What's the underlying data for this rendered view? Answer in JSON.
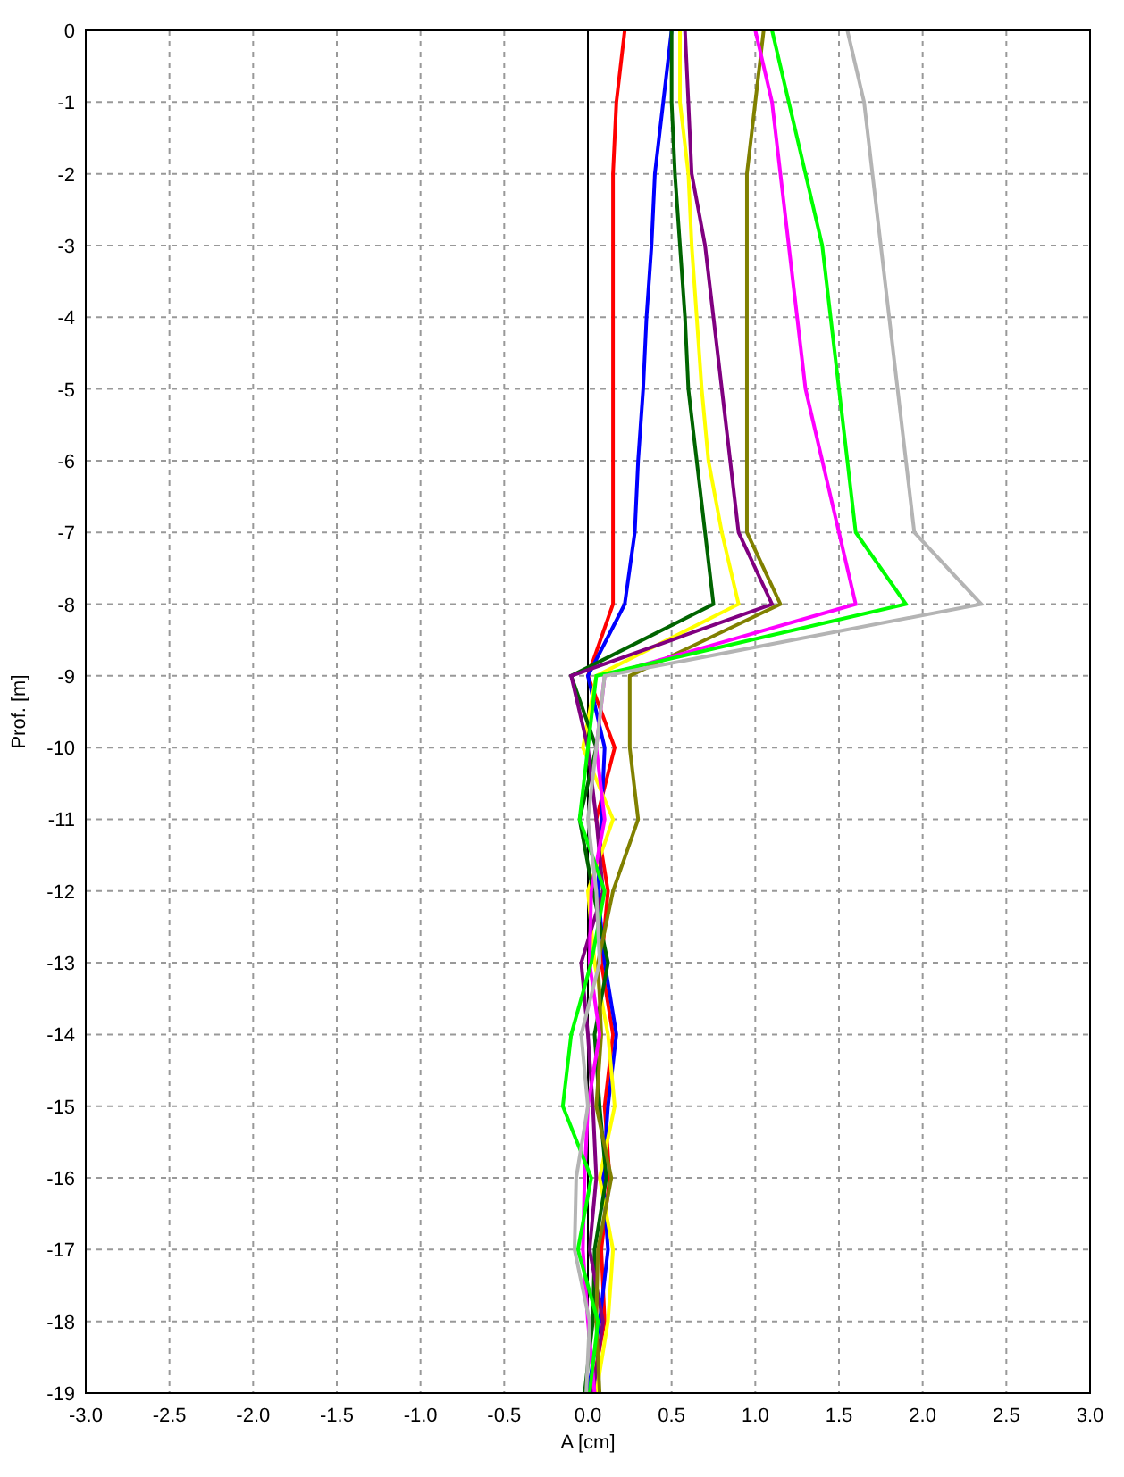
{
  "chart": {
    "chart_data": {
      "type": "line",
      "orientation": "horizontal",
      "grid": true,
      "xlabel": "A [cm]",
      "ylabel": "Prof. [m]",
      "xlim": [
        -3,
        3
      ],
      "xticks": [
        {
          "value": -3,
          "label": "-3.0"
        },
        {
          "value": -2.5,
          "label": "-2.5"
        },
        {
          "value": -2,
          "label": "-2.0"
        },
        {
          "value": -1.5,
          "label": "-1.5"
        },
        {
          "value": -1,
          "label": "-1.0"
        },
        {
          "value": -0.5,
          "label": "-0.5"
        },
        {
          "value": 0,
          "label": "0.0"
        },
        {
          "value": 0.5,
          "label": "0.5"
        },
        {
          "value": 1,
          "label": "1.0"
        },
        {
          "value": 1.5,
          "label": "1.5"
        },
        {
          "value": 2,
          "label": "2.0"
        },
        {
          "value": 2.5,
          "label": "2.5"
        },
        {
          "value": 3,
          "label": "3.0"
        }
      ],
      "categories": [
        "0",
        "-1",
        "-2",
        "-3",
        "-4",
        "-5",
        "-6",
        "-7",
        "-8",
        "-9",
        "-10",
        "-11",
        "-12",
        "-13",
        "-14",
        "-15",
        "-16",
        "-17",
        "-18",
        "-19"
      ],
      "series": [
        {
          "color": "#ff0000",
          "values": [
            0.22,
            0.17,
            0.15,
            0.15,
            0.15,
            0.15,
            0.15,
            0.15,
            0.15,
            0.0,
            0.16,
            0.05,
            0.12,
            0.08,
            0.15,
            0.1,
            0.13,
            0.08,
            0.1,
            0.02
          ]
        },
        {
          "color": "#0000ff",
          "values": [
            0.5,
            0.45,
            0.4,
            0.38,
            0.35,
            0.33,
            0.3,
            0.28,
            0.22,
            0.0,
            0.1,
            0.08,
            0.06,
            0.1,
            0.17,
            0.12,
            0.09,
            0.12,
            0.07,
            0.0
          ]
        },
        {
          "color": "#ffff00",
          "values": [
            0.55,
            0.55,
            0.6,
            0.62,
            0.65,
            0.68,
            0.72,
            0.8,
            0.9,
            0.05,
            -0.03,
            0.15,
            0.0,
            0.04,
            0.12,
            0.16,
            0.07,
            0.15,
            0.12,
            0.05
          ]
        },
        {
          "color": "#006400",
          "values": [
            0.5,
            0.5,
            0.52,
            0.55,
            0.58,
            0.6,
            0.65,
            0.7,
            0.75,
            -0.1,
            0.05,
            -0.05,
            0.03,
            0.12,
            0.04,
            0.07,
            0.11,
            0.04,
            0.03,
            -0.02
          ]
        },
        {
          "color": "#800080",
          "values": [
            0.58,
            0.6,
            0.62,
            0.7,
            0.75,
            0.8,
            0.85,
            0.9,
            1.1,
            -0.1,
            0.0,
            0.05,
            0.09,
            -0.04,
            0.0,
            0.03,
            0.05,
            0.01,
            0.09,
            0.03
          ]
        },
        {
          "color": "#808000",
          "values": [
            1.05,
            1.0,
            0.95,
            0.95,
            0.95,
            0.95,
            0.95,
            0.95,
            1.15,
            0.25,
            0.25,
            0.3,
            0.15,
            0.06,
            0.08,
            0.05,
            0.14,
            0.06,
            0.05,
            0.07
          ]
        },
        {
          "color": "#ff00ff",
          "values": [
            1.0,
            1.1,
            1.15,
            1.2,
            1.25,
            1.3,
            1.4,
            1.5,
            1.6,
            0.1,
            0.05,
            0.1,
            0.02,
            0.01,
            0.07,
            0.0,
            -0.02,
            -0.03,
            0.0,
            0.04
          ]
        },
        {
          "color": "#00ff00",
          "values": [
            1.1,
            1.2,
            1.3,
            1.4,
            1.45,
            1.5,
            1.55,
            1.6,
            1.9,
            0.05,
            0.0,
            -0.05,
            0.1,
            0.02,
            -0.1,
            -0.15,
            0.02,
            -0.06,
            0.06,
            0.01
          ]
        },
        {
          "color": "#b4b4b4",
          "values": [
            1.55,
            1.65,
            1.7,
            1.75,
            1.8,
            1.85,
            1.9,
            1.95,
            2.35,
            0.1,
            0.05,
            0.0,
            0.05,
            0.07,
            -0.04,
            0.0,
            -0.07,
            -0.08,
            0.01,
            -0.01
          ]
        }
      ]
    }
  }
}
